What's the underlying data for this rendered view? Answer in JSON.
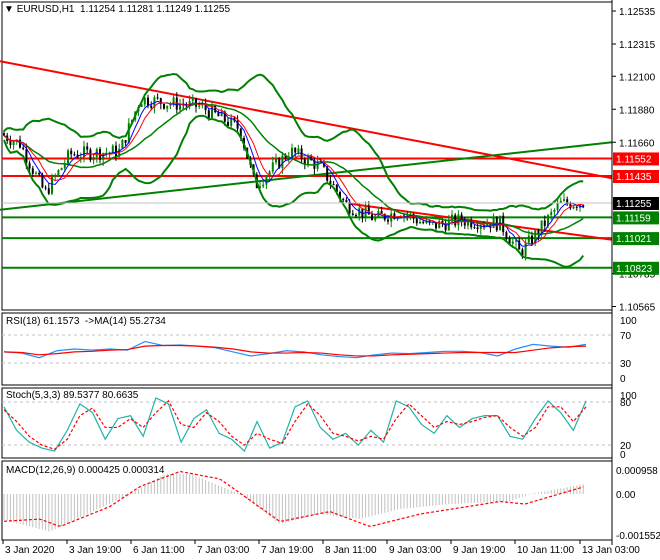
{
  "header": {
    "symbol": "EURUSD,H1",
    "ohlc": "1.11254 1.11281 1.11249 1.11255"
  },
  "colors": {
    "bull": "#008000",
    "bear": "#000000",
    "red": "#ff0000",
    "green": "#008000",
    "rsi": "#1e90ff",
    "stoch": "#20b2aa",
    "hist": "#c0c0c0"
  },
  "chart_data": [
    {
      "type": "candlestick",
      "title": "EURUSD,H1",
      "ylim": [
        1.10565,
        1.12535
      ],
      "yticks": [
        "1.12535",
        "1.12315",
        "1.12100",
        "1.11880",
        "1.11660",
        "1.10785",
        "1.10565"
      ],
      "price_tags": [
        {
          "text": "1.11552",
          "color": "#ff0000",
          "value": 1.11552
        },
        {
          "text": "1.11435",
          "color": "#ff0000",
          "value": 1.11435
        },
        {
          "text": "1.11255",
          "color": "#000000",
          "value": 1.11255
        },
        {
          "text": "1.11159",
          "color": "#008000",
          "value": 1.11159
        },
        {
          "text": "1.11021",
          "color": "#008000",
          "value": 1.11021
        },
        {
          "text": "1.10823",
          "color": "#008000",
          "value": 1.10823
        }
      ],
      "close_path": [
        [
          0,
          1.1172
        ],
        [
          20,
          1.1165
        ],
        [
          45,
          1.1132
        ],
        [
          70,
          1.1158
        ],
        [
          120,
          1.116
        ],
        [
          140,
          1.1195
        ],
        [
          170,
          1.1192
        ],
        [
          200,
          1.119
        ],
        [
          240,
          1.1175
        ],
        [
          255,
          1.1137
        ],
        [
          290,
          1.116
        ],
        [
          320,
          1.115
        ],
        [
          345,
          1.1125
        ],
        [
          375,
          1.1115
        ],
        [
          400,
          1.112
        ],
        [
          430,
          1.111
        ],
        [
          460,
          1.1114
        ],
        [
          500,
          1.1112
        ],
        [
          520,
          1.1092
        ],
        [
          540,
          1.1108
        ],
        [
          560,
          1.1125
        ],
        [
          585,
          1.1126
        ]
      ],
      "trendlines": [
        {
          "color": "#ff0000",
          "from": [
            0,
            1.122
          ],
          "to": [
            612,
            1.1142
          ]
        },
        {
          "color": "#ff0000",
          "from": [
            350,
            1.1125
          ],
          "to": [
            612,
            1.1101
          ]
        },
        {
          "color": "#008000",
          "from": [
            0,
            1.1121
          ],
          "to": [
            612,
            1.1166
          ]
        }
      ],
      "hlines": [
        {
          "value": 1.11552,
          "color": "#ff0000"
        },
        {
          "value": 1.11435,
          "color": "#ff0000"
        },
        {
          "value": 1.11159,
          "color": "#008000"
        },
        {
          "value": 1.11021,
          "color": "#008000"
        },
        {
          "value": 1.10823,
          "color": "#008000"
        }
      ]
    },
    {
      "type": "line",
      "title": "RSI(18) 61.1573  ->MA(14) 55.2734",
      "ylim": [
        0,
        100
      ],
      "yticks": [
        "100",
        "70",
        "30",
        "0"
      ],
      "series": [
        {
          "name": "RSI",
          "values": [
            45,
            43,
            35,
            47,
            50,
            48,
            50,
            48,
            63,
            56,
            57,
            55,
            52,
            45,
            38,
            42,
            47,
            45,
            40,
            37,
            35,
            40,
            43,
            42,
            44,
            46,
            46,
            44,
            38,
            50,
            58,
            55,
            53,
            58
          ]
        },
        {
          "name": "MA",
          "values": [
            45,
            44,
            40,
            42,
            45,
            46,
            48,
            49,
            55,
            56,
            56,
            55,
            53,
            50,
            45,
            43,
            43,
            44,
            43,
            40,
            38,
            38,
            40,
            41,
            42,
            43,
            44,
            44,
            44,
            44,
            48,
            52,
            54,
            55
          ]
        }
      ]
    },
    {
      "type": "line",
      "title": "Stoch(5,3,3) 89.5377 80.6635",
      "ylim": [
        0,
        100
      ],
      "yticks": [
        "100",
        "80",
        "20",
        "0"
      ],
      "series": [
        {
          "name": "%K",
          "values": [
            80,
            40,
            20,
            10,
            5,
            40,
            85,
            70,
            25,
            60,
            65,
            30,
            95,
            85,
            20,
            60,
            75,
            35,
            25,
            5,
            55,
            10,
            20,
            80,
            90,
            45,
            25,
            35,
            15,
            40,
            20,
            90,
            80,
            50,
            35,
            65,
            45,
            60,
            65,
            65,
            30,
            25,
            60,
            90,
            70,
            40,
            90
          ]
        },
        {
          "name": "%D",
          "values": [
            75,
            55,
            30,
            15,
            8,
            25,
            65,
            78,
            45,
            45,
            60,
            45,
            70,
            90,
            50,
            45,
            70,
            55,
            30,
            15,
            35,
            25,
            18,
            55,
            85,
            65,
            35,
            30,
            22,
            30,
            25,
            60,
            85,
            65,
            45,
            55,
            50,
            55,
            62,
            65,
            45,
            30,
            45,
            80,
            80,
            55,
            80
          ]
        }
      ]
    },
    {
      "type": "bar",
      "title": "MACD(12,26,9) 0.000425 0.000314",
      "ylim": [
        -0.001552,
        0.000958
      ],
      "yticks": [
        "0.000958",
        "0.00",
        "-0.001552"
      ],
      "series": [
        {
          "name": "MACD",
          "keypoints": [
            [
              0,
              -0.001
            ],
            [
              50,
              -0.0015
            ],
            [
              130,
              0
            ],
            [
              165,
              0.0008
            ],
            [
              190,
              0.0008
            ],
            [
              240,
              0
            ],
            [
              280,
              -0.0012
            ],
            [
              320,
              -0.0008
            ],
            [
              360,
              -0.001
            ],
            [
              400,
              -0.0006
            ],
            [
              450,
              -0.0004
            ],
            [
              510,
              -0.0003
            ],
            [
              530,
              0
            ],
            [
              585,
              0.0004
            ]
          ]
        },
        {
          "name": "Signal",
          "keypoints": [
            [
              0,
              -0.0011
            ],
            [
              40,
              -0.001
            ],
            [
              60,
              -0.0013
            ],
            [
              110,
              -0.0005
            ],
            [
              140,
              0.0003
            ],
            [
              180,
              0.0009
            ],
            [
              220,
              0.0006
            ],
            [
              280,
              -0.0011
            ],
            [
              330,
              -0.0007
            ],
            [
              370,
              -0.0013
            ],
            [
              420,
              -0.0008
            ],
            [
              500,
              -0.0003
            ],
            [
              525,
              -0.0004
            ],
            [
              585,
              0.0003
            ]
          ]
        }
      ]
    }
  ],
  "xaxis": {
    "labels": [
      "3 Jan 2020",
      "3 Jan 19:00",
      "6 Jan 11:00",
      "7 Jan 03:00",
      "7 Jan 19:00",
      "8 Jan 11:00",
      "9 Jan 03:00",
      "9 Jan 19:00",
      "10 Jan 11:00",
      "13 Jan 03:00"
    ]
  }
}
